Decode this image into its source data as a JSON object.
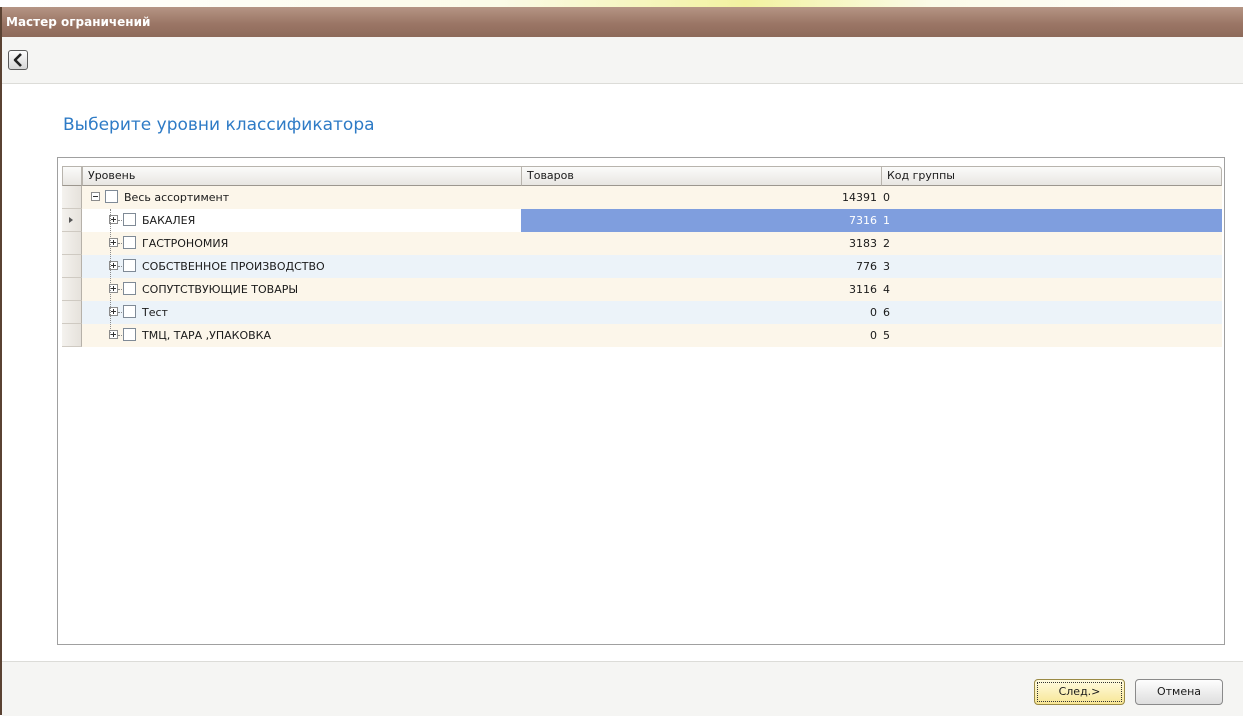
{
  "window": {
    "title": "Мастер ограничений"
  },
  "toolbar": {
    "back_icon": "chevron-left-icon"
  },
  "page": {
    "heading": "Выберите уровни классификатора"
  },
  "grid": {
    "columns": [
      "Уровень",
      "Товаров",
      "Код группы"
    ],
    "rows": [
      {
        "level": "Весь ассортимент",
        "count": "14391",
        "code": "0"
      },
      {
        "level": "БАКАЛЕЯ",
        "count": "7316",
        "code": "1"
      },
      {
        "level": "ГАСТРОНОМИЯ",
        "count": "3183",
        "code": "2"
      },
      {
        "level": "СОБСТВЕННОЕ ПРОИЗВОДСТВО",
        "count": "776",
        "code": "3"
      },
      {
        "level": "СОПУТСТВУЮЩИЕ ТОВАРЫ",
        "count": "3116",
        "code": "4"
      },
      {
        "level": "Тест",
        "count": "0",
        "code": "6"
      },
      {
        "level": "ТМЦ, ТАРА ,УПАКОВКА",
        "count": "0",
        "code": "5"
      }
    ],
    "selected_row": "БАКАЛЕЯ"
  },
  "footer": {
    "next_label": "След.>",
    "cancel_label": "Отмена"
  },
  "colors": {
    "title_bar": "#9b7666",
    "heading": "#2e7bc6",
    "selection": "#7f9ede",
    "row_alt_warm": "#fcf6ea",
    "row_alt_cool": "#ecf3f9"
  }
}
